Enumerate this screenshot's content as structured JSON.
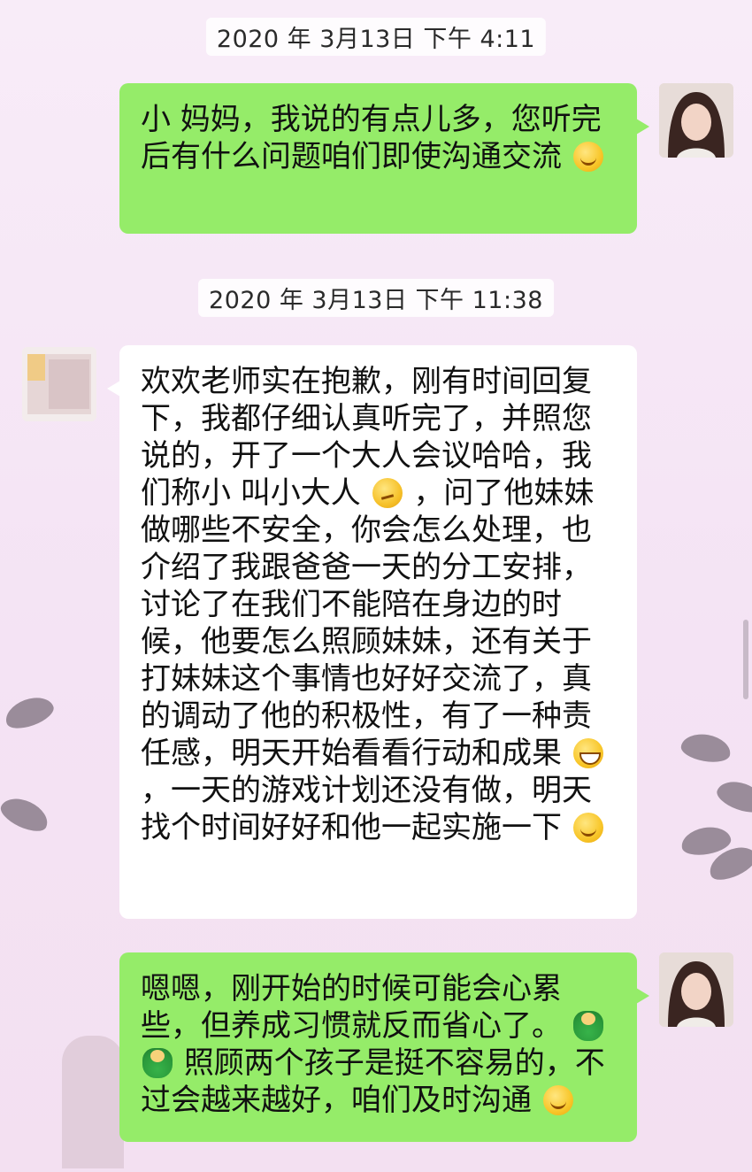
{
  "timestamps": [
    "2020 年 3月13日 下午 4:11",
    "2020 年 3月13日 下午 11:38"
  ],
  "messages": [
    {
      "side": "sent",
      "text": "小 妈妈，我说的有点儿多，您听完后有什么问题咱们即使沟通交流",
      "emojis": [
        "smile"
      ]
    },
    {
      "side": "received",
      "segments": [
        "欢欢老师实在抱歉，刚有时间回复下，我都仔细认真听完了，并照您说的，开了一个大人会议哈哈，我们称小 叫小大人",
        "，问了他妹妹做哪些不安全，你会怎么处理，也介绍了我跟爸爸一天的分工安排，讨论了在我们不能陪在身边的时候，他要怎么照顾妹妹，还有关于打妹妹这个事情也好好交流了，真的调动了他的积极性，有了一种责任感，明天开始看看行动和成果",
        "，一天的游戏计划还没有做，明天找个时间好好和他一起实施一下"
      ]
    },
    {
      "side": "sent",
      "segments": [
        "嗯嗯，刚开始的时候可能会心累些，但养成习惯就反而省心了。",
        "照顾两个孩子是挺不容易的，不过会越来越好，咱们及时沟通"
      ]
    }
  ],
  "icons": {
    "smile": "smile-emoji",
    "think": "thinking-emoji",
    "grin": "grin-emoji",
    "sprout": "sprout-emoji"
  }
}
